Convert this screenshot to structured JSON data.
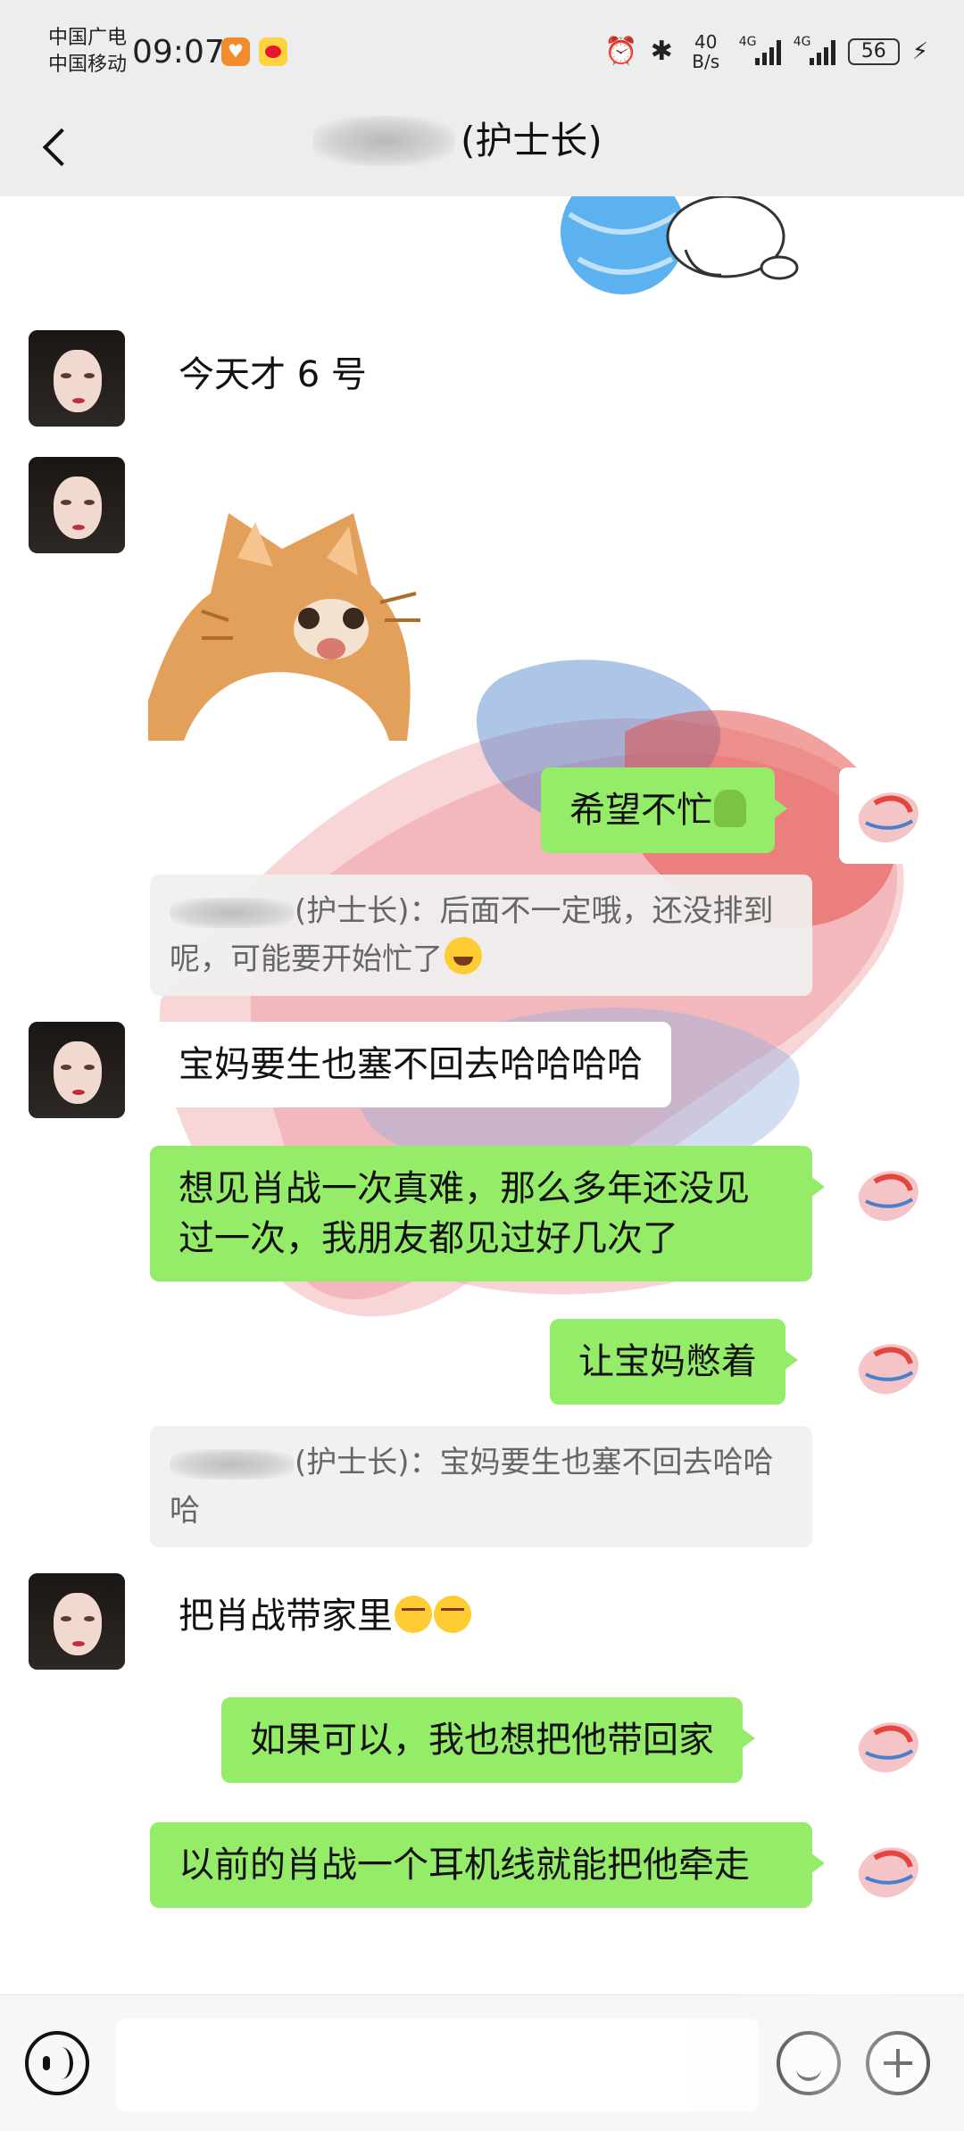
{
  "status_bar": {
    "carrier_1": "中国广电",
    "carrier_2": "中国移动",
    "time": "09:07",
    "net_speed_value": "40",
    "net_speed_unit": "B/s",
    "signal_tag_1": "4G",
    "signal_tag_2": "4G",
    "battery_level": "56",
    "alarm_icon": "alarm-icon",
    "bluetooth_icon": "bluetooth-icon"
  },
  "header": {
    "title": "(护士长)",
    "back_icon": "back-chevron-icon",
    "more_icon": "more-dots-icon"
  },
  "messages": [
    {
      "side": "left",
      "text": "今天才 6 号"
    },
    {
      "side": "left",
      "type": "sticker",
      "sticker": "cat-sticker"
    },
    {
      "side": "right",
      "text": "希望不忙",
      "emoji": "pray-emoji"
    },
    {
      "type": "quote",
      "text": "(护士长)：后面不一定哦，还没排到呢，可能要开始忙了",
      "emoji": "laugh-cry-emoji"
    },
    {
      "side": "left",
      "text": "宝妈要生也塞不回去哈哈哈哈"
    },
    {
      "side": "right",
      "text": "想见肖战一次真难，那么多年还没见过一次，我朋友都见过好几次了"
    },
    {
      "side": "right",
      "text": "让宝妈憋着"
    },
    {
      "type": "quote",
      "text": "(护士长)：宝妈要生也塞不回去哈哈哈"
    },
    {
      "side": "left",
      "text": "把肖战带家里",
      "emoji": "smirk-emoji"
    },
    {
      "side": "right",
      "text": "如果可以，我也想把他带回家"
    },
    {
      "side": "right",
      "text": "以前的肖战一个耳机线就能把他牵走"
    }
  ],
  "input_bar": {
    "voice_icon": "voice-icon",
    "emoji_icon": "emoji-icon",
    "plus_icon": "plus-icon",
    "input_value": ""
  },
  "colors": {
    "right_bubble": "#95ec69",
    "left_bubble": "#ffffff",
    "header_bg": "#ededed"
  }
}
